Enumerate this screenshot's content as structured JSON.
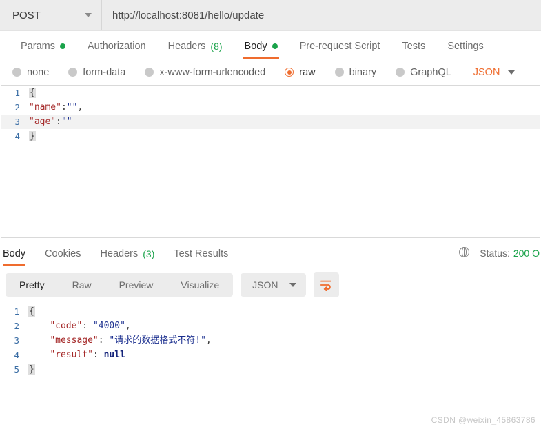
{
  "request_bar": {
    "method": "POST",
    "method_caret_icon": "chevron-down-icon",
    "url": "http://localhost:8081/hello/update"
  },
  "request_tabs": [
    {
      "label": "Params",
      "badge_dot": true,
      "active": false
    },
    {
      "label": "Authorization",
      "active": false
    },
    {
      "label": "Headers",
      "count": "(8)",
      "active": false
    },
    {
      "label": "Body",
      "badge_dot": true,
      "active": true
    },
    {
      "label": "Pre-request Script",
      "active": false
    },
    {
      "label": "Tests",
      "active": false
    },
    {
      "label": "Settings",
      "active": false
    }
  ],
  "body_types": [
    {
      "label": "none",
      "selected": false
    },
    {
      "label": "form-data",
      "selected": false
    },
    {
      "label": "x-www-form-urlencoded",
      "selected": false
    },
    {
      "label": "raw",
      "selected": true
    },
    {
      "label": "binary",
      "selected": false
    },
    {
      "label": "GraphQL",
      "selected": false
    }
  ],
  "body_format": {
    "label": "JSON",
    "caret_icon": "chevron-down-icon"
  },
  "request_body": {
    "lines": [
      {
        "num": "1",
        "highlighted": false,
        "tokens": [
          {
            "t": "brace",
            "v": "{"
          }
        ]
      },
      {
        "num": "2",
        "highlighted": false,
        "tokens": [
          {
            "t": "key",
            "v": "\"name\""
          },
          {
            "t": "punc",
            "v": ":"
          },
          {
            "t": "str",
            "v": "\"\""
          },
          {
            "t": "punc",
            "v": ","
          }
        ]
      },
      {
        "num": "3",
        "highlighted": true,
        "tokens": [
          {
            "t": "key",
            "v": "\"age\""
          },
          {
            "t": "punc",
            "v": ":"
          },
          {
            "t": "str",
            "v": "\"\""
          }
        ]
      },
      {
        "num": "4",
        "highlighted": false,
        "tokens": [
          {
            "t": "brace",
            "v": "}"
          }
        ]
      }
    ]
  },
  "response_tabs": [
    {
      "label": "Body",
      "active": true
    },
    {
      "label": "Cookies",
      "active": false
    },
    {
      "label": "Headers",
      "count": "(3)",
      "active": false
    },
    {
      "label": "Test Results",
      "active": false
    }
  ],
  "response_status": {
    "globe_icon": "globe-icon",
    "status_label": "Status:",
    "status_value": "200 O"
  },
  "response_toolbar": {
    "views": [
      {
        "label": "Pretty",
        "active": true
      },
      {
        "label": "Raw",
        "active": false
      },
      {
        "label": "Preview",
        "active": false
      },
      {
        "label": "Visualize",
        "active": false
      }
    ],
    "format": {
      "label": "JSON",
      "caret_icon": "chevron-down-icon"
    },
    "wrap_button_icon": "word-wrap-icon"
  },
  "response_body": {
    "lines": [
      {
        "num": "1",
        "highlighted": false,
        "tokens": [
          {
            "t": "brace",
            "v": "{"
          }
        ]
      },
      {
        "num": "2",
        "highlighted": false,
        "tokens": [
          {
            "t": "punc",
            "v": "    "
          },
          {
            "t": "key",
            "v": "\"code\""
          },
          {
            "t": "punc",
            "v": ": "
          },
          {
            "t": "str",
            "v": "\"4000\""
          },
          {
            "t": "punc",
            "v": ","
          }
        ]
      },
      {
        "num": "3",
        "highlighted": false,
        "tokens": [
          {
            "t": "punc",
            "v": "    "
          },
          {
            "t": "key",
            "v": "\"message\""
          },
          {
            "t": "punc",
            "v": ": "
          },
          {
            "t": "str",
            "v": "\"请求的数据格式不符!\""
          },
          {
            "t": "punc",
            "v": ","
          }
        ]
      },
      {
        "num": "4",
        "highlighted": false,
        "tokens": [
          {
            "t": "punc",
            "v": "    "
          },
          {
            "t": "key",
            "v": "\"result\""
          },
          {
            "t": "punc",
            "v": ": "
          },
          {
            "t": "null",
            "v": "null"
          }
        ]
      },
      {
        "num": "5",
        "highlighted": false,
        "tokens": [
          {
            "t": "brace",
            "v": "}"
          }
        ]
      }
    ]
  },
  "watermark": "CSDN @weixin_45863786"
}
